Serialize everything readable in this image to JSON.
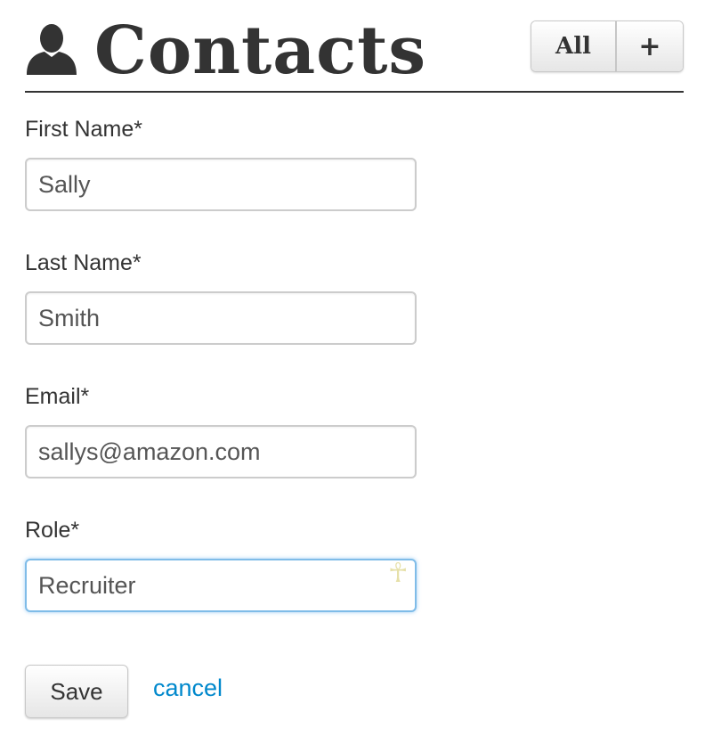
{
  "header": {
    "title": "Contacts",
    "icon": "person-icon",
    "buttons": {
      "all_label": "All",
      "add_label": "+"
    }
  },
  "form": {
    "first_name": {
      "label": "First Name*",
      "value": "Sally"
    },
    "last_name": {
      "label": "Last Name*",
      "value": "Smith"
    },
    "email": {
      "label": "Email*",
      "value": "sallys@amazon.com"
    },
    "role": {
      "label": "Role*",
      "value": "Recruiter",
      "focused": true,
      "autofill_icon": "ankh-icon"
    }
  },
  "actions": {
    "save_label": "Save",
    "cancel_label": "cancel"
  },
  "colors": {
    "text": "#333333",
    "link": "#0088cc",
    "focus_border": "#7fbce8"
  }
}
